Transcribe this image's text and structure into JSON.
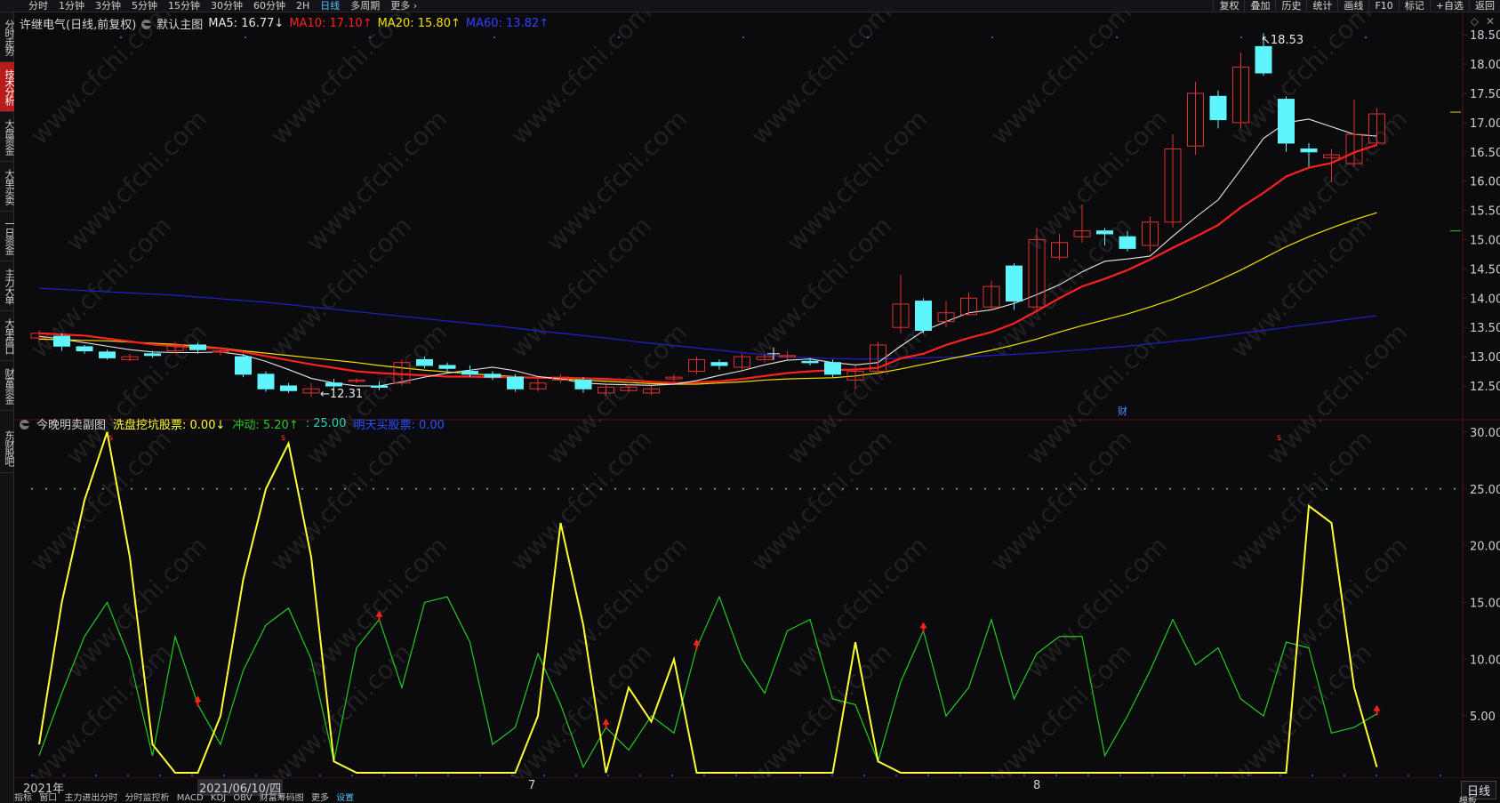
{
  "toolbar": {
    "period_tabs": [
      "分时",
      "1分钟",
      "3分钟",
      "5分钟",
      "15分钟",
      "30分钟",
      "60分钟",
      "2H",
      "日线",
      "多周期",
      "更多 ›"
    ],
    "active_period": "日线",
    "buttons": [
      "复权",
      "叠加",
      "历史",
      "统计",
      "画线",
      "F10",
      "标记",
      "+自选",
      "返回"
    ]
  },
  "left_tabs": [
    {
      "label": "分时走势",
      "active": false
    },
    {
      "label": "技术分析",
      "active": true
    },
    {
      "label": "大盘资金",
      "active": false
    },
    {
      "label": "大单买卖",
      "active": false
    },
    {
      "label": "一日资金",
      "active": false
    },
    {
      "label": "主力大单",
      "active": false
    },
    {
      "label": "大单盘口",
      "active": false
    },
    {
      "label": "财富资金",
      "active": false
    },
    {
      "label": "东财股吧",
      "active": false
    }
  ],
  "main_legend": {
    "title": "许继电气(日线,前复权)",
    "template": "默认主图",
    "ma5": "MA5: 16.77↓",
    "ma10": "MA10: 17.10↑",
    "ma20": "MA20: 15.80↑",
    "ma60": "MA60: 13.82↑"
  },
  "sub_legend": {
    "title": "今晚明卖副图",
    "xipan": "洗盘挖坑股票: 0.00↓",
    "chongdong": "冲动: 5.20↑",
    "line25": ": 25.00",
    "mingtian": "明天买股票: 0.00"
  },
  "annotations": {
    "high": "18.53",
    "low": "12.31",
    "cai": "财"
  },
  "colors": {
    "up": "#e03030",
    "down": "#5ff5ff",
    "ma5": "#e6e6e6",
    "ma10": "#ff2020",
    "ma20": "#f0e000",
    "ma60": "#2020d0",
    "xipan": "#ffff33",
    "chongdong": "#22cc22",
    "line25": "#22d6b0",
    "mingtian": "#2f4fff",
    "grid": "#5a1010"
  },
  "x_axis_labels": [
    "2021年",
    "2021/06/10/四",
    "7",
    "8"
  ],
  "bottom_tabs": [
    "指标",
    "窗口",
    "主力进出分时",
    "分时监控析",
    "MACD",
    "KDJ",
    "OBV",
    "财富筹码图",
    "更多",
    "设置"
  ],
  "bottom_right": {
    "period": "日线",
    "template": "模板"
  },
  "chart_data": [
    {
      "type": "candlestick",
      "title": "许继电气(日线,前复权)",
      "ylim": [
        12.15,
        18.68
      ],
      "y_ticks": [
        "12.50",
        "13.00",
        "13.50",
        "14.00",
        "14.50",
        "15.00",
        "15.50",
        "16.00",
        "16.50",
        "17.00",
        "17.50",
        "18.00",
        "18.50"
      ],
      "candles": [
        {
          "o": 13.32,
          "c": 13.4,
          "h": 13.45,
          "l": 13.25
        },
        {
          "o": 13.35,
          "c": 13.18,
          "h": 13.4,
          "l": 13.1
        },
        {
          "o": 13.17,
          "c": 13.1,
          "h": 13.2,
          "l": 13.05
        },
        {
          "o": 13.08,
          "c": 12.98,
          "h": 13.12,
          "l": 12.95
        },
        {
          "o": 12.95,
          "c": 13.0,
          "h": 13.05,
          "l": 12.92
        },
        {
          "o": 13.05,
          "c": 13.02,
          "h": 13.1,
          "l": 12.98
        },
        {
          "o": 13.1,
          "c": 13.2,
          "h": 13.25,
          "l": 13.05
        },
        {
          "o": 13.2,
          "c": 13.12,
          "h": 13.24,
          "l": 13.05
        },
        {
          "o": 13.08,
          "c": 13.1,
          "h": 13.14,
          "l": 13.02
        },
        {
          "o": 13.0,
          "c": 12.7,
          "h": 13.05,
          "l": 12.65
        },
        {
          "o": 12.7,
          "c": 12.45,
          "h": 12.75,
          "l": 12.4
        },
        {
          "o": 12.5,
          "c": 12.42,
          "h": 12.55,
          "l": 12.38
        },
        {
          "o": 12.38,
          "c": 12.45,
          "h": 12.55,
          "l": 12.31
        },
        {
          "o": 12.55,
          "c": 12.5,
          "h": 12.62,
          "l": 12.45
        },
        {
          "o": 12.58,
          "c": 12.6,
          "h": 12.63,
          "l": 12.55
        },
        {
          "o": 12.5,
          "c": 12.48,
          "h": 12.58,
          "l": 12.43
        },
        {
          "o": 12.55,
          "c": 12.9,
          "h": 12.95,
          "l": 12.5
        },
        {
          "o": 12.95,
          "c": 12.85,
          "h": 13.0,
          "l": 12.8
        },
        {
          "o": 12.85,
          "c": 12.8,
          "h": 12.9,
          "l": 12.75
        },
        {
          "o": 12.75,
          "c": 12.7,
          "h": 12.85,
          "l": 12.65
        },
        {
          "o": 12.7,
          "c": 12.65,
          "h": 12.75,
          "l": 12.6
        },
        {
          "o": 12.65,
          "c": 12.45,
          "h": 12.7,
          "l": 12.4
        },
        {
          "o": 12.45,
          "c": 12.55,
          "h": 12.65,
          "l": 12.4
        },
        {
          "o": 12.6,
          "c": 12.65,
          "h": 12.7,
          "l": 12.55
        },
        {
          "o": 12.6,
          "c": 12.45,
          "h": 12.65,
          "l": 12.38
        },
        {
          "o": 12.38,
          "c": 12.48,
          "h": 12.52,
          "l": 12.33
        },
        {
          "o": 12.42,
          "c": 12.48,
          "h": 12.53,
          "l": 12.38
        },
        {
          "o": 12.38,
          "c": 12.45,
          "h": 12.5,
          "l": 12.34
        },
        {
          "o": 12.62,
          "c": 12.65,
          "h": 12.7,
          "l": 12.55
        },
        {
          "o": 12.75,
          "c": 12.95,
          "h": 13.0,
          "l": 12.7
        },
        {
          "o": 12.9,
          "c": 12.85,
          "h": 12.95,
          "l": 12.78
        },
        {
          "o": 12.82,
          "c": 13.0,
          "h": 13.05,
          "l": 12.78
        },
        {
          "o": 12.95,
          "c": 13.0,
          "h": 13.05,
          "l": 12.9
        },
        {
          "o": 13.02,
          "c": 13.02,
          "h": 13.1,
          "l": 12.95
        },
        {
          "o": 12.92,
          "c": 12.9,
          "h": 12.98,
          "l": 12.85
        },
        {
          "o": 12.9,
          "c": 12.7,
          "h": 12.95,
          "l": 12.65
        },
        {
          "o": 12.6,
          "c": 12.75,
          "h": 12.85,
          "l": 12.45
        },
        {
          "o": 12.75,
          "c": 13.2,
          "h": 13.25,
          "l": 12.7
        },
        {
          "o": 13.5,
          "c": 13.9,
          "h": 14.4,
          "l": 13.4
        },
        {
          "o": 13.95,
          "c": 13.45,
          "h": 14.0,
          "l": 13.4
        },
        {
          "o": 13.6,
          "c": 13.75,
          "h": 13.95,
          "l": 13.5
        },
        {
          "o": 13.72,
          "c": 14.0,
          "h": 14.1,
          "l": 13.7
        },
        {
          "o": 13.85,
          "c": 14.2,
          "h": 14.3,
          "l": 13.8
        },
        {
          "o": 14.55,
          "c": 13.95,
          "h": 14.6,
          "l": 13.8
        },
        {
          "o": 13.85,
          "c": 15.0,
          "h": 15.2,
          "l": 13.8
        },
        {
          "o": 14.7,
          "c": 14.95,
          "h": 15.1,
          "l": 14.65
        },
        {
          "o": 15.05,
          "c": 15.15,
          "h": 15.6,
          "l": 14.95
        },
        {
          "o": 15.15,
          "c": 15.1,
          "h": 15.2,
          "l": 14.9
        },
        {
          "o": 15.05,
          "c": 14.85,
          "h": 15.15,
          "l": 14.8
        },
        {
          "o": 14.9,
          "c": 15.3,
          "h": 15.4,
          "l": 14.8
        },
        {
          "o": 15.3,
          "c": 16.55,
          "h": 16.8,
          "l": 15.2
        },
        {
          "o": 16.6,
          "c": 17.5,
          "h": 17.7,
          "l": 16.45
        },
        {
          "o": 17.45,
          "c": 17.05,
          "h": 17.55,
          "l": 16.9
        },
        {
          "o": 17.0,
          "c": 17.95,
          "h": 18.2,
          "l": 16.9
        },
        {
          "o": 18.3,
          "c": 17.85,
          "h": 18.53,
          "l": 17.8
        },
        {
          "o": 17.4,
          "c": 16.65,
          "h": 17.45,
          "l": 16.5
        },
        {
          "o": 16.55,
          "c": 16.5,
          "h": 16.65,
          "l": 16.25
        },
        {
          "o": 16.4,
          "c": 16.45,
          "h": 16.55,
          "l": 15.98
        },
        {
          "o": 16.3,
          "c": 16.8,
          "h": 17.4,
          "l": 16.25
        },
        {
          "o": 16.65,
          "c": 17.15,
          "h": 17.25,
          "l": 16.6
        }
      ],
      "ma5": [
        13.35,
        13.3,
        13.24,
        13.18,
        13.12,
        13.08,
        13.07,
        13.07,
        13.08,
        13.03,
        12.92,
        12.78,
        12.63,
        12.55,
        12.5,
        12.5,
        12.57,
        12.65,
        12.72,
        12.77,
        12.82,
        12.76,
        12.66,
        12.62,
        12.55,
        12.53,
        12.52,
        12.51,
        12.53,
        12.59,
        12.68,
        12.76,
        12.86,
        12.94,
        12.96,
        12.9,
        12.86,
        12.9,
        13.18,
        13.44,
        13.6,
        13.75,
        13.8,
        13.91,
        14.06,
        14.23,
        14.45,
        14.63,
        14.67,
        14.72,
        15.06,
        15.38,
        15.68,
        16.2,
        16.73,
        17.0,
        17.06,
        16.93,
        16.8,
        16.77
      ],
      "ma10": [
        13.4,
        13.38,
        13.36,
        13.31,
        13.26,
        13.21,
        13.18,
        13.16,
        13.14,
        13.08,
        13.01,
        12.94,
        12.87,
        12.81,
        12.75,
        12.72,
        12.7,
        12.68,
        12.66,
        12.66,
        12.65,
        12.65,
        12.64,
        12.64,
        12.63,
        12.62,
        12.6,
        12.57,
        12.55,
        12.56,
        12.58,
        12.62,
        12.67,
        12.72,
        12.75,
        12.77,
        12.78,
        12.81,
        12.97,
        13.05,
        13.2,
        13.32,
        13.42,
        13.57,
        13.78,
        14.0,
        14.2,
        14.33,
        14.48,
        14.66,
        14.86,
        15.05,
        15.25,
        15.55,
        15.8,
        16.08,
        16.23,
        16.31,
        16.49,
        16.62
      ],
      "ma20": [
        13.3,
        13.29,
        13.28,
        13.27,
        13.25,
        13.23,
        13.21,
        13.18,
        13.15,
        13.1,
        13.06,
        13.02,
        12.98,
        12.94,
        12.9,
        12.85,
        12.81,
        12.77,
        12.74,
        12.71,
        12.68,
        12.66,
        12.64,
        12.62,
        12.6,
        12.58,
        12.56,
        12.54,
        12.53,
        12.53,
        12.55,
        12.57,
        12.6,
        12.62,
        12.63,
        12.64,
        12.67,
        12.72,
        12.79,
        12.87,
        12.95,
        13.03,
        13.11,
        13.2,
        13.3,
        13.42,
        13.53,
        13.63,
        13.73,
        13.85,
        13.98,
        14.13,
        14.3,
        14.48,
        14.68,
        14.88,
        15.05,
        15.2,
        15.34,
        15.46
      ],
      "ma60": [
        14.17,
        14.15,
        14.13,
        14.11,
        14.09,
        14.07,
        14.05,
        14.02,
        13.99,
        13.96,
        13.93,
        13.89,
        13.85,
        13.81,
        13.77,
        13.73,
        13.69,
        13.65,
        13.61,
        13.57,
        13.53,
        13.49,
        13.44,
        13.4,
        13.36,
        13.32,
        13.27,
        13.23,
        13.19,
        13.15,
        13.11,
        13.07,
        13.03,
        13.0,
        12.98,
        12.97,
        12.96,
        12.96,
        12.97,
        12.98,
        12.99,
        13.0,
        13.02,
        13.04,
        13.06,
        13.09,
        13.12,
        13.15,
        13.18,
        13.22,
        13.26,
        13.3,
        13.35,
        13.4,
        13.45,
        13.5,
        13.55,
        13.6,
        13.65,
        13.7
      ]
    },
    {
      "type": "line",
      "title": "今晚明卖副图",
      "ylim": [
        0,
        31
      ],
      "y_ticks": [
        "5.00",
        "10.00",
        "15.00",
        "20.00",
        "25.00",
        "30.00"
      ],
      "series": [
        {
          "name": "洗盘挖坑股票",
          "values": [
            2.5,
            15,
            24,
            30,
            19,
            2.5,
            0,
            0,
            5,
            17,
            25,
            29,
            19,
            1,
            0,
            0,
            0,
            0,
            0,
            0,
            0,
            0,
            5,
            22,
            13,
            0,
            7.5,
            4.5,
            10,
            0,
            0,
            0,
            0,
            0,
            0,
            0,
            11.5,
            1,
            0,
            0,
            0,
            0,
            0,
            0,
            0,
            0,
            0,
            0,
            0,
            0,
            0,
            0,
            0,
            0,
            0,
            0,
            23.5,
            22,
            7.5,
            0.5
          ]
        },
        {
          "name": "冲动",
          "values": [
            1.5,
            7,
            12,
            15,
            10,
            1.5,
            12,
            6,
            2.5,
            9,
            13,
            14.5,
            10,
            1,
            11,
            13.5,
            7.5,
            15,
            15.5,
            11.5,
            2.5,
            4,
            10.5,
            6,
            0.5,
            4,
            2,
            5,
            3.5,
            11,
            15.5,
            10,
            7,
            12.5,
            13.5,
            6.5,
            6,
            1,
            8,
            12.5,
            5,
            7.5,
            13.5,
            6.5,
            10.5,
            12,
            12,
            1.5,
            5,
            9,
            13.5,
            9.5,
            11,
            6.5,
            5,
            11.5,
            11,
            3.5,
            4,
            5.2
          ]
        },
        {
          "name": "",
          "values": [
            25
          ]
        },
        {
          "name": "明天买股票",
          "values": [
            0
          ]
        }
      ],
      "markers": [
        7,
        15,
        25,
        29,
        39,
        59
      ]
    }
  ]
}
